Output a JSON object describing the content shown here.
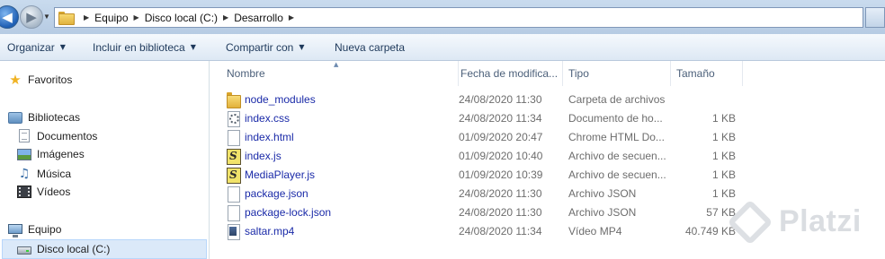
{
  "address_bar": {
    "path": [
      "Equipo",
      "Disco local (C:)",
      "Desarrollo"
    ]
  },
  "toolbar": {
    "organize": "Organizar",
    "include_library": "Incluir en biblioteca",
    "share": "Compartir con",
    "new_folder": "Nueva carpeta"
  },
  "nav": {
    "favorites": "Favoritos",
    "libraries": "Bibliotecas",
    "documents": "Documentos",
    "images": "Imágenes",
    "music": "Música",
    "videos": "Vídeos",
    "computer": "Equipo",
    "local_disk": "Disco local (C:)"
  },
  "columns": {
    "name": "Nombre",
    "date": "Fecha de modifica...",
    "type": "Tipo",
    "size": "Tamaño"
  },
  "files": [
    {
      "name": "node_modules",
      "date": "24/08/2020 11:30",
      "type": "Carpeta de archivos",
      "size": "",
      "icon": "folder-icon"
    },
    {
      "name": "index.css",
      "date": "24/08/2020 11:34",
      "type": "Documento de ho...",
      "size": "1 KB",
      "icon": "css-file-icon"
    },
    {
      "name": "index.html",
      "date": "01/09/2020 20:47",
      "type": "Chrome HTML Do...",
      "size": "1 KB",
      "icon": "html-file-icon"
    },
    {
      "name": "index.js",
      "date": "01/09/2020 10:40",
      "type": "Archivo de secuen...",
      "size": "1 KB",
      "icon": "js-file-icon"
    },
    {
      "name": "MediaPlayer.js",
      "date": "01/09/2020 10:39",
      "type": "Archivo de secuen...",
      "size": "1 KB",
      "icon": "js-file-icon"
    },
    {
      "name": "package.json",
      "date": "24/08/2020 11:30",
      "type": "Archivo JSON",
      "size": "1 KB",
      "icon": "json-file-icon"
    },
    {
      "name": "package-lock.json",
      "date": "24/08/2020 11:30",
      "type": "Archivo JSON",
      "size": "57 KB",
      "icon": "json-file-icon"
    },
    {
      "name": "saltar.mp4",
      "date": "24/08/2020 11:34",
      "type": "Vídeo MP4",
      "size": "40.749 KB",
      "icon": "video-file-icon"
    }
  ],
  "watermark": "Platzi",
  "colors": {
    "link_blue": "#1a2aa8",
    "header_text": "#4c607a",
    "selection": "#dbe9f9"
  }
}
